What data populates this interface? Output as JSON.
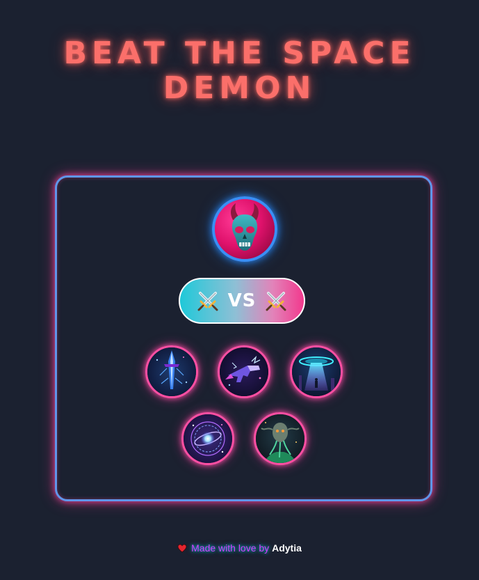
{
  "game": {
    "title_line1": "BEAT THE SPACE",
    "title_line2": "DEMON",
    "vs_label": "VS",
    "boss": {
      "name": "space-demon",
      "icon": "demon-skull-icon"
    },
    "heroes": [
      {
        "icon": "crystal-sword-icon"
      },
      {
        "icon": "plasma-blaster-icon"
      },
      {
        "icon": "ufo-tractor-beam-icon"
      },
      {
        "icon": "galaxy-portal-icon"
      },
      {
        "icon": "tentacle-alien-icon"
      }
    ]
  },
  "footer": {
    "heart": "heart-icon",
    "made_with_love": "Made with love by",
    "author": "Adytia"
  },
  "colors": {
    "background": "#1b2130",
    "title": "#fb6f6a",
    "arena_border": "#5f96ea",
    "arena_glow": "#ff46a0",
    "boss_ring": "#3a8ff5",
    "hero_ring": "#ff4fa3",
    "footer_text": "#d83cff"
  }
}
